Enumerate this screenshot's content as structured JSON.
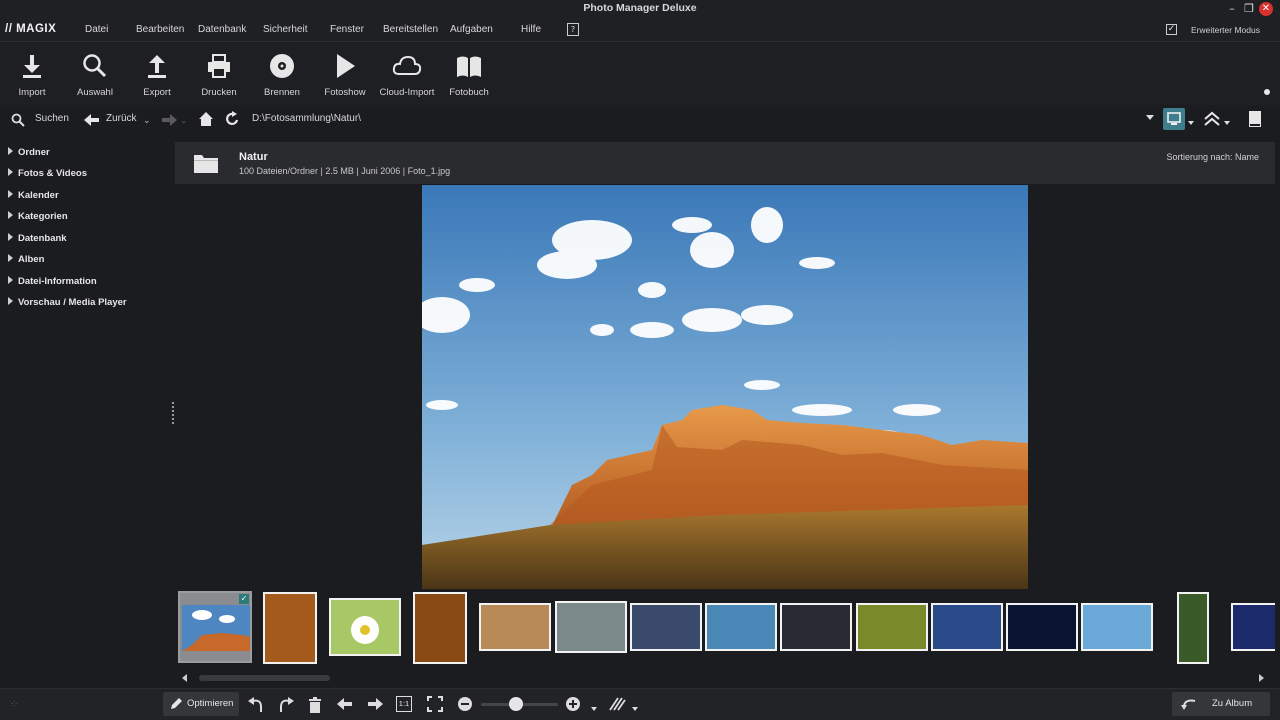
{
  "app": {
    "title": "Photo Manager Deluxe",
    "logo": "// MAGIX"
  },
  "menu": [
    "Datei",
    "Bearbeiten",
    "Datenbank",
    "Sicherheit",
    "Fenster",
    "Bereitstellen",
    "Aufgaben",
    "Hilfe"
  ],
  "advanced_mode": {
    "label": "Erweiterter Modus",
    "checked": true
  },
  "toolbar": [
    "Import",
    "Auswahl",
    "Export",
    "Drucken",
    "Brennen",
    "Fotoshow",
    "Cloud-Import",
    "Fotobuch"
  ],
  "nav": {
    "search": "Suchen",
    "back": "Zurück",
    "path": "D:\\Fotosammlung\\Natur\\"
  },
  "sidebar": [
    "Ordner",
    "Fotos & Videos",
    "Kalender",
    "Kategorien",
    "Datenbank",
    "Alben",
    "Datei-Information",
    "Vorschau / Media Player"
  ],
  "folder": {
    "name": "Natur",
    "meta": "100 Dateien/Ordner | 2.5 MB | Juni 2006 | Foto_1.jpg",
    "sort": "Sortierung nach: Name"
  },
  "bottom": {
    "optimize": "Optimieren",
    "to_album": "Zu Album",
    "zoom_1to1": "1:1"
  },
  "colors": {
    "accent": "#3e7e8c",
    "background": "#1b1c1f",
    "close": "#d9312f"
  }
}
